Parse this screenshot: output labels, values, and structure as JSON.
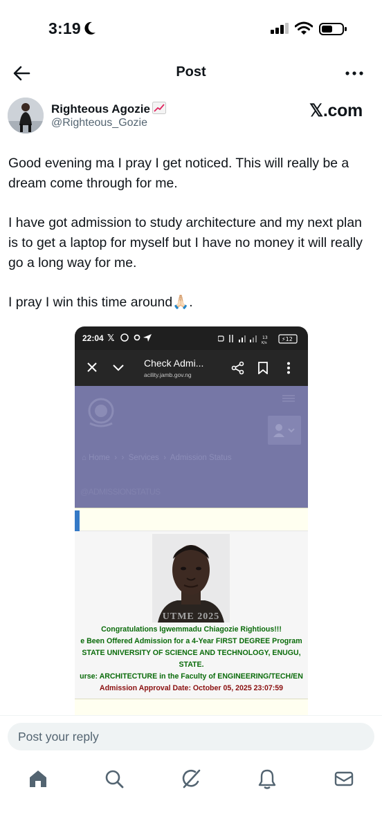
{
  "status_bar": {
    "time": "3:19"
  },
  "header": {
    "title": "Post"
  },
  "author": {
    "name": "Righteous Agozie",
    "handle": "@Righteous_Gozie",
    "source": "𝕏.com"
  },
  "post": {
    "paragraphs": [
      "Good evening ma I pray I get noticed. This will really be a dream come through for me.",
      "I have got admission to study architecture and my next plan is to get a laptop for myself but I have no money it will really go a long way for me.",
      "I pray I win this time around🙏🏻."
    ]
  },
  "media": {
    "status_time": "22:04",
    "status_right": "13 K/s",
    "battery": "12",
    "tab_title": "Check Admi...",
    "url": "acility.jamb.gov.ng",
    "breadcrumb": [
      "Home",
      "Services",
      "Admission Status"
    ],
    "section_label": "@ADMISSIONSTATUS",
    "photo_caption": "UTME 2025",
    "lines": [
      "Congratulations Igwemmadu Chiagozie Rightious!!!",
      "e Been Offered Admission for a 4-Year FIRST DEGREE Program",
      "STATE UNIVERSITY OF SCIENCE AND TECHNOLOGY, ENUGU,",
      "STATE.",
      "urse: ARCHITECTURE in the Faculty of ENGINEERING/TECH/EN",
      "Admission Approval Date: October 05, 2025 23:07:59"
    ]
  },
  "reply": {
    "placeholder": "Post your reply"
  },
  "colors": {
    "accent": "#1d9bf0",
    "text": "#0f1419",
    "muted": "#536471",
    "admission_green": "#0a6b0a",
    "admission_red": "#8a1010",
    "page_header": "#7677a6"
  }
}
